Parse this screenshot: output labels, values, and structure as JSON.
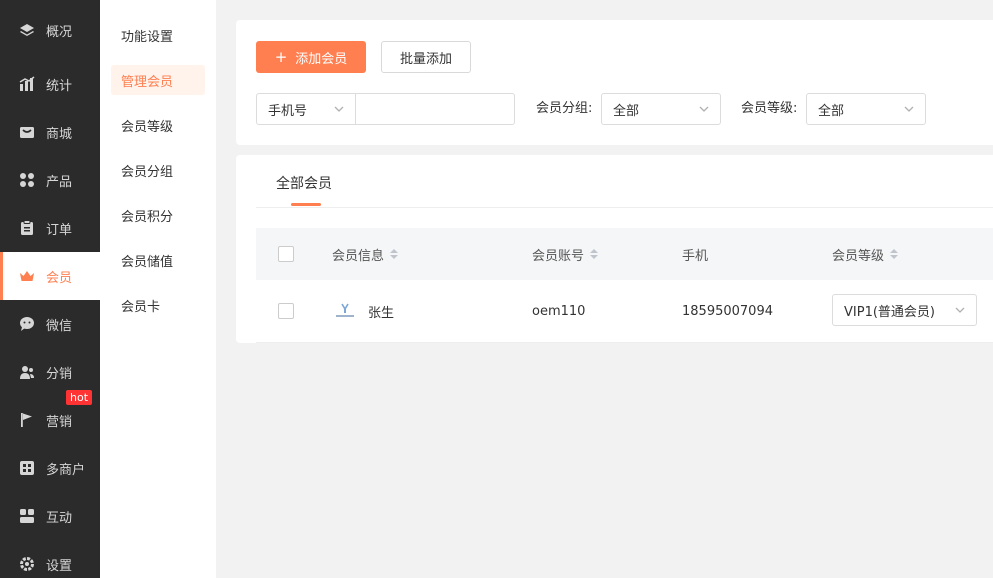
{
  "nav": {
    "items": [
      {
        "label": "概况",
        "icon": "layers-icon"
      },
      {
        "label": "统计",
        "icon": "chart-icon"
      },
      {
        "label": "商城",
        "icon": "store-icon"
      },
      {
        "label": "产品",
        "icon": "grid-icon"
      },
      {
        "label": "订单",
        "icon": "clipboard-icon"
      },
      {
        "label": "会员",
        "icon": "crown-icon"
      },
      {
        "label": "微信",
        "icon": "chat-icon"
      },
      {
        "label": "分销",
        "icon": "users-icon"
      },
      {
        "label": "营销",
        "icon": "flag-icon",
        "badge": "hot"
      },
      {
        "label": "多商户",
        "icon": "merchant-icon"
      },
      {
        "label": "互动",
        "icon": "interact-icon"
      },
      {
        "label": "设置",
        "icon": "gear-icon"
      }
    ]
  },
  "subnav": {
    "items": [
      "功能设置",
      "管理会员",
      "会员等级",
      "会员分组",
      "会员积分",
      "会员储值",
      "会员卡"
    ]
  },
  "toolbar": {
    "add_member": "添加会员",
    "batch_add": "批量添加"
  },
  "filters": {
    "phone_select": "手机号",
    "phone_input": "",
    "group_label": "会员分组:",
    "group_value": "全部",
    "level_label": "会员等级:",
    "level_value": "全部"
  },
  "tabs": {
    "all_members": "全部会员"
  },
  "table": {
    "headers": {
      "info": "会员信息",
      "account": "会员账号",
      "phone": "手机",
      "level": "会员等级"
    },
    "rows": [
      {
        "name": "张生",
        "account": "oem110",
        "phone": "18595007094",
        "level": "VIP1(普通会员)"
      }
    ]
  },
  "colors": {
    "accent": "#ff7f50",
    "nav_bg": "#2b2b2b",
    "hot": "#ff3333"
  }
}
